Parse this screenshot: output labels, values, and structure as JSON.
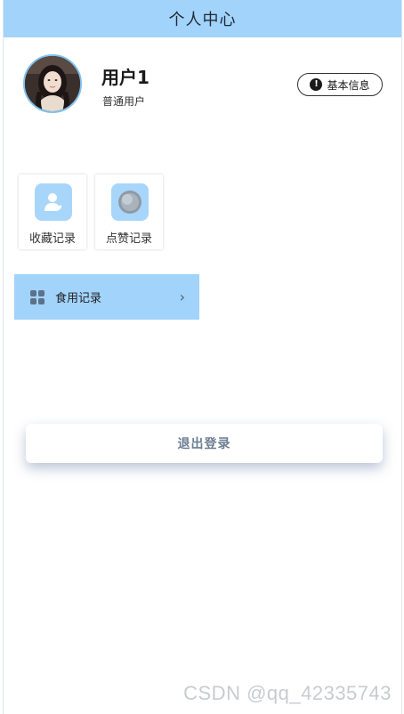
{
  "header": {
    "title": "个人中心"
  },
  "profile": {
    "username": "用户1",
    "user_type": "普通用户",
    "info_button_label": "基本信息",
    "info_icon": "exclamation-circle-icon"
  },
  "cards": [
    {
      "label": "收藏记录",
      "icon": "favorite-user-icon"
    },
    {
      "label": "点赞记录",
      "icon": "like-record-icon"
    }
  ],
  "menu": {
    "items": [
      {
        "label": "食用记录",
        "icon": "grid-apps-icon",
        "chevron": "›"
      }
    ]
  },
  "logout": {
    "label": "退出登录"
  },
  "watermark": {
    "text": "CSDN @qq_42335743"
  },
  "colors": {
    "header_bg": "#a1d3fb",
    "menu_bg": "#a1d3fb",
    "card_icon_bg": "#a8d6fb",
    "logout_text": "#6b7e93"
  }
}
